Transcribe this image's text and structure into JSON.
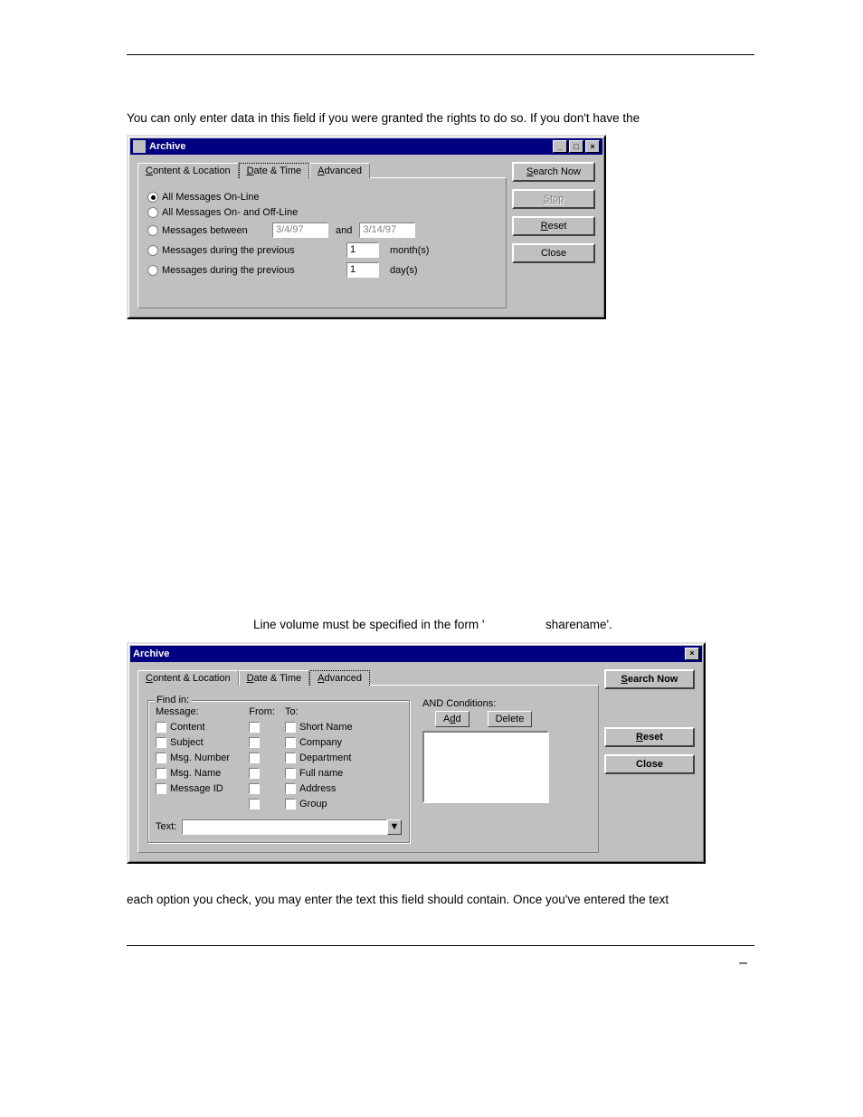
{
  "page": {
    "intro_line": "You can only enter data in this field if you were granted the rights to do so. If you don't have the",
    "mid_line_pre": "Line volume must be specified in the form '",
    "mid_line_post": "sharename'.",
    "outro_line": "each option you check, you may enter the text this field should contain. Once you've entered the text",
    "footer_mark": "–"
  },
  "dialog1": {
    "title": "Archive",
    "tabs": {
      "content": "Content & Location",
      "date": "Date & Time",
      "advanced": "Advanced"
    },
    "radios": {
      "r1": "All Messages On-Line",
      "r2": "All Messages On- and Off-Line",
      "r3": "Messages between",
      "r3_and": "and",
      "r3_d1": "3/4/97",
      "r3_d2": "3/14/97",
      "r4": "Messages during the previous",
      "r4_val": "1",
      "r4_unit": "month(s)",
      "r5": "Messages during the previous",
      "r5_val": "1",
      "r5_unit": "day(s)"
    },
    "buttons": {
      "search": "Search Now",
      "stop": "Stop",
      "reset": "Reset",
      "close": "Close"
    }
  },
  "dialog2": {
    "title": "Archive",
    "tabs": {
      "content": "Content & Location",
      "date": "Date & Time",
      "advanced": "Advanced"
    },
    "group": {
      "legend": "Find in:",
      "col_msg": "Message:",
      "col_from": "From:",
      "col_to": "To:",
      "msg_items": [
        "Content",
        "Subject",
        "Msg. Number",
        "Msg. Name",
        "Message ID"
      ],
      "to_items": [
        "Short Name",
        "Company",
        "Department",
        "Full name",
        "Address",
        "Group"
      ],
      "text_label": "Text:"
    },
    "cond": {
      "label": "AND Conditions:",
      "add": "Add",
      "delete": "Delete"
    },
    "buttons": {
      "search": "Search Now",
      "reset": "Reset",
      "close": "Close"
    }
  }
}
